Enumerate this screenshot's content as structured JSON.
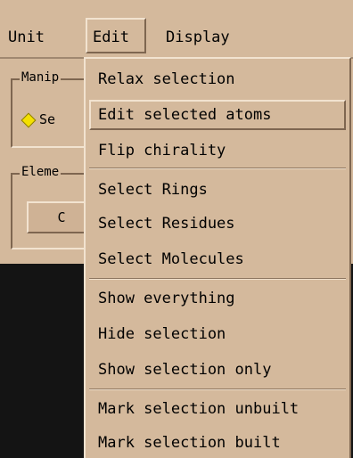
{
  "menubar": {
    "unit": "Unit",
    "edit": "Edit",
    "display": "Display"
  },
  "panel": {
    "manipulate_title": "Manip",
    "selected_radio": "Se",
    "element_title": "Eleme",
    "element_button": "C"
  },
  "edit_menu": {
    "items": [
      "Relax selection",
      "Edit selected atoms",
      "Flip chirality",
      "Select Rings",
      "Select Residues",
      "Select Molecules",
      "Show everything",
      "Hide selection",
      "Show selection only",
      "Mark selection unbuilt",
      "Mark selection built"
    ],
    "active_index": 1
  },
  "colors": {
    "background": "#d4b99c",
    "dark_area": "#141414",
    "radio_selected": "#f4e000"
  }
}
